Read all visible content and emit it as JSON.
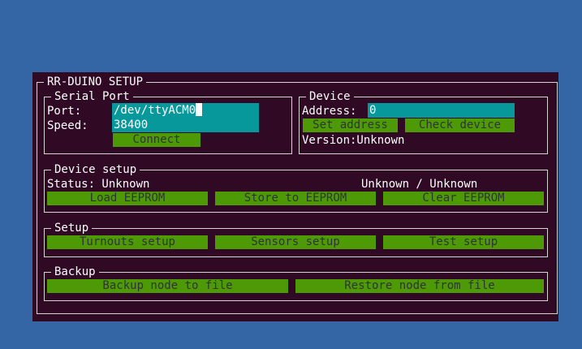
{
  "dialog": {
    "title": "RR-DUINO SETUP"
  },
  "serial_port": {
    "title": "Serial Port",
    "port_label": "Port:",
    "port_value": "/dev/ttyACM0",
    "speed_label": "Speed:",
    "speed_value": "38400",
    "connect_label": "Connect"
  },
  "device": {
    "title": "Device",
    "address_label": "Address:",
    "address_value": "0",
    "set_address_label": "Set address",
    "check_device_label": "Check device",
    "version_text": "Version:Unknown"
  },
  "device_setup": {
    "title": "Device setup",
    "status_text": "Status: Unknown",
    "counts_text": "Unknown / Unknown",
    "load_label": "Load EEPROM",
    "store_label": "Store to EEPROM",
    "clear_label": "Clear EEPROM"
  },
  "setup": {
    "title": "Setup",
    "turnouts_label": "Turnouts setup",
    "sensors_label": "Sensors setup",
    "test_label": "Test setup"
  },
  "backup": {
    "title": "Backup",
    "backup_label": "Backup node to file",
    "restore_label": "Restore node from file"
  },
  "colors": {
    "background": "#3465a4",
    "dialog": "#300a24",
    "field": "#06989a",
    "button": "#4e9a06"
  }
}
